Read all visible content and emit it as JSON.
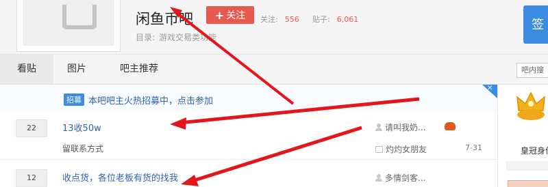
{
  "header": {
    "forum_name": "闲鱼币吧",
    "follow_label": "关注",
    "follow_icon": "plus-icon",
    "followers_label": "关注:",
    "followers_value": "556",
    "posts_label": "贴子:",
    "posts_value": "6,061",
    "catalog_label": "目录:",
    "catalog_value": "游戏交易类功能",
    "sign_label": "签"
  },
  "nav": {
    "tabs": [
      {
        "label": "看贴",
        "active": true
      },
      {
        "label": "图片",
        "active": false
      },
      {
        "label": "吧主推荐",
        "active": false
      }
    ],
    "search_placeholder": "吧内搜"
  },
  "recruit": {
    "badge": "招募",
    "text": "本吧吧主火热招募中，点击参加"
  },
  "threads": [
    {
      "reply_count": "22",
      "title": "13收50w",
      "abstract": "留联系方式",
      "author": "请叫我奶...",
      "last_reply_user": "灼灼女朋友",
      "date": "7-31",
      "has_badge": true
    },
    {
      "reply_count": "12",
      "title": "收点货，各位老板有货的找我",
      "author": "多情剑客...",
      "last_reply_user": "",
      "date": ""
    }
  ],
  "sidebar": {
    "crown_label": "皇冠身份"
  },
  "colors": {
    "accent_blue": "#3b8be0",
    "follow_red": "#e85a4f",
    "link_blue": "#2d64b3",
    "arrow_red": "#e3161b"
  }
}
